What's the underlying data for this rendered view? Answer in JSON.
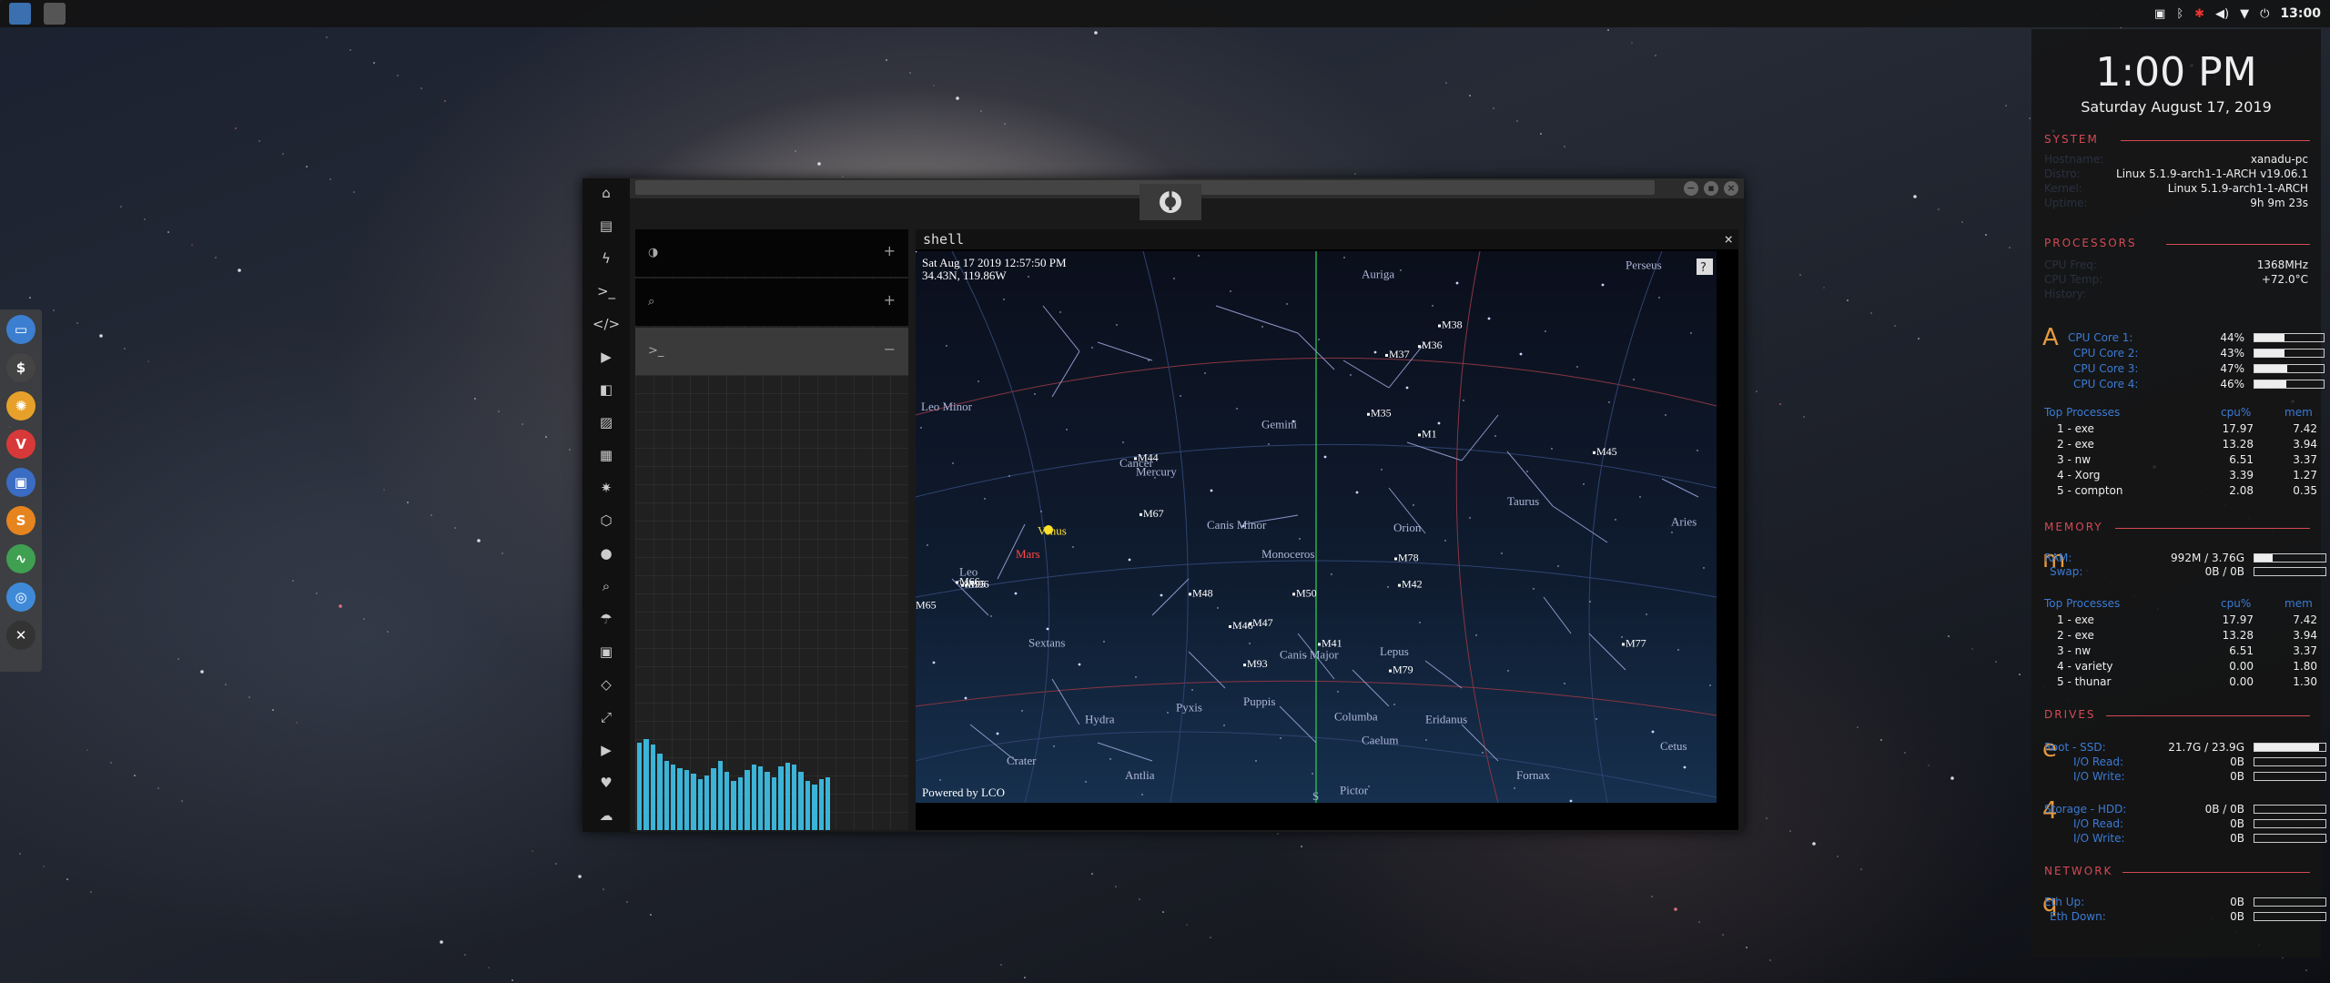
{
  "topbar": {
    "time": "13:00"
  },
  "window": {
    "shell_title": "shell",
    "map": {
      "datetime": "Sat Aug 17 2019 12:57:50 PM",
      "coords": "34.43N, 119.86W",
      "powered": "Powered by LCO",
      "help": "?",
      "labels": [
        "Auriga",
        "Perseus",
        "Leo Minor",
        "Gemini",
        "Cancer",
        "Mercury",
        "Canis Minor",
        "Monoceros",
        "Orion",
        "Taurus",
        "Aries",
        "Venus",
        "Mars",
        "Leo",
        "Sextans",
        "Hydra",
        "Pyxis",
        "Puppis",
        "Columba",
        "Eridanus",
        "Caelum",
        "Crater",
        "Antlia",
        "Pictor",
        "Fornax",
        "Cetus",
        "Lepus",
        "Canis Major",
        "S"
      ],
      "messier": [
        "M38",
        "M37",
        "M36",
        "M35",
        "M1",
        "M45",
        "M44",
        "M67",
        "M78",
        "M42",
        "M48",
        "M50",
        "M47",
        "M46",
        "M41",
        "M93",
        "M79",
        "M77",
        "M65",
        "M66",
        "M95",
        "M96"
      ]
    },
    "left_panel": {
      "rows": [
        {
          "icon": "◑",
          "plus": "+"
        },
        {
          "icon": "⌕",
          "plus": "+"
        },
        {
          "icon": ">_",
          "plus": "−"
        }
      ],
      "spectrum": [
        0.48,
        0.5,
        0.47,
        0.42,
        0.38,
        0.36,
        0.34,
        0.33,
        0.31,
        0.28,
        0.3,
        0.34,
        0.38,
        0.32,
        0.27,
        0.29,
        0.33,
        0.36,
        0.35,
        0.32,
        0.29,
        0.35,
        0.37,
        0.36,
        0.32,
        0.27,
        0.25,
        0.28,
        0.29
      ]
    }
  },
  "conky": {
    "time": "1:00 PM",
    "date": "Saturday August 17, 2019",
    "system": {
      "title": "SYSTEM",
      "rows": [
        {
          "k": "Hostname:",
          "v": "xanadu-pc"
        },
        {
          "k": "Distro:",
          "v": "Linux 5.1.9-arch1-1-ARCH v19.06.1"
        },
        {
          "k": "Kernel:",
          "v": "Linux 5.1.9-arch1-1-ARCH"
        },
        {
          "k": "Uptime:",
          "v": "9h 9m 23s"
        }
      ]
    },
    "processors": {
      "title": "PROCESSORS",
      "rows": [
        {
          "k": "CPU Freq:",
          "v": "1368MHz"
        },
        {
          "k": "CPU Temp:",
          "v": "+72.0°C"
        },
        {
          "k": "History:",
          "v": ""
        }
      ],
      "letter": "A",
      "cores": [
        {
          "k": "CPU Core 1:",
          "v": "44%",
          "p": 0.44
        },
        {
          "k": "CPU Core 2:",
          "v": "43%",
          "p": 0.43
        },
        {
          "k": "CPU Core 3:",
          "v": "47%",
          "p": 0.47
        },
        {
          "k": "CPU Core 4:",
          "v": "46%",
          "p": 0.46
        }
      ],
      "top_title": "Top Processes",
      "col1": "cpu%",
      "col2": "mem",
      "top": [
        {
          "n": "1 - exe",
          "c": "17.97",
          "m": "7.42"
        },
        {
          "n": "2 - exe",
          "c": "13.28",
          "m": "3.94"
        },
        {
          "n": "3 - nw",
          "c": "6.51",
          "m": "3.37"
        },
        {
          "n": "4 - Xorg",
          "c": "3.39",
          "m": "1.27"
        },
        {
          "n": "5 - compton",
          "c": "2.08",
          "m": "0.35"
        }
      ]
    },
    "memory": {
      "title": "MEMORY",
      "letter": "m",
      "rows": [
        {
          "k": "RAM:",
          "v": "992M / 3.76G",
          "p": 0.26
        },
        {
          "k": "Swap:",
          "v": "0B / 0B",
          "p": 0
        }
      ],
      "top_title": "Top Processes",
      "col1": "cpu%",
      "col2": "mem",
      "top": [
        {
          "n": "1 - exe",
          "c": "17.97",
          "m": "7.42"
        },
        {
          "n": "2 - exe",
          "c": "13.28",
          "m": "3.94"
        },
        {
          "n": "3 - nw",
          "c": "6.51",
          "m": "3.37"
        },
        {
          "n": "4 - variety",
          "c": "0.00",
          "m": "1.80"
        },
        {
          "n": "5 - thunar",
          "c": "0.00",
          "m": "1.30"
        }
      ]
    },
    "drives": {
      "title": "DRIVES",
      "root_letter": "e",
      "root": [
        {
          "k": "Root - SSD:",
          "v": "21.7G / 23.9G",
          "p": 0.91
        },
        {
          "k": "I/O Read:",
          "v": "0B",
          "p": 0
        },
        {
          "k": "I/O Write:",
          "v": "0B",
          "p": 0
        }
      ],
      "storage_letter": "4",
      "storage": [
        {
          "k": "Storage - HDD:",
          "v": "0B / 0B",
          "p": 0
        },
        {
          "k": "I/O Read:",
          "v": "0B",
          "p": 0
        },
        {
          "k": "I/O Write:",
          "v": "0B",
          "p": 0
        }
      ]
    },
    "network": {
      "title": "NETWORK",
      "letter": "q",
      "rows": [
        {
          "k": "Eth Up:",
          "v": "0B",
          "p": 0
        },
        {
          "k": "Eth Down:",
          "v": "0B",
          "p": 0
        }
      ]
    }
  }
}
